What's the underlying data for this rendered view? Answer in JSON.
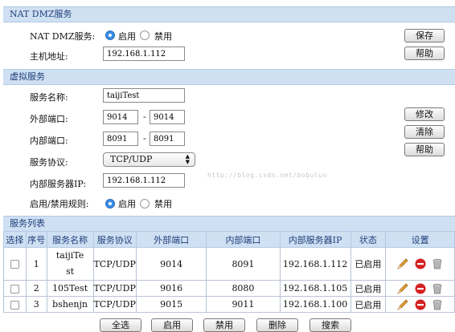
{
  "nat": {
    "header": "NAT DMZ服务",
    "service_label": "NAT DMZ服务:",
    "enable": "启用",
    "disable": "禁用",
    "host_label": "主机地址:",
    "host_value": "192.168.1.112",
    "save": "保存",
    "help": "帮助"
  },
  "virtual": {
    "header": "虚拟服务",
    "name_label": "服务名称:",
    "name_value": "taijiTest",
    "ext_port_label": "外部端口:",
    "ext_from": "9014",
    "ext_to": "9014",
    "int_port_label": "内部端口:",
    "int_from": "8091",
    "int_to": "8091",
    "dash": "-",
    "protocol_label": "服务协议:",
    "protocol_value": "TCP/UDP",
    "ip_label": "内部服务器IP:",
    "ip_value": "192.168.1.112",
    "rule_label": "启用/禁用规则:",
    "enable": "启用",
    "disable": "禁用",
    "modify": "修改",
    "clear": "清除",
    "help": "帮助",
    "watermark": "http://blog.csdn.net/bobuluo"
  },
  "list": {
    "header": "服务列表",
    "columns": [
      "选择",
      "序号",
      "服务名称",
      "服务协议",
      "外部端口",
      "内部端口",
      "内部服务器IP",
      "状态",
      "设置"
    ],
    "rows": [
      {
        "index": "1",
        "name": "taijiTe st",
        "protocol": "TCP/UDP",
        "ext": "9014",
        "int": "8091",
        "ip": "192.168.1.112",
        "status": "已启用"
      },
      {
        "index": "2",
        "name": "105Test",
        "protocol": "TCP/UDP",
        "ext": "9016",
        "int": "8080",
        "ip": "192.168.1.105",
        "status": "已启用"
      },
      {
        "index": "3",
        "name": "bshenjn",
        "protocol": "TCP/UDP",
        "ext": "9015",
        "int": "9011",
        "ip": "192.168.1.100",
        "status": "已启用"
      }
    ],
    "icons": [
      "edit-pencil-icon",
      "disable-icon",
      "delete-trash-icon"
    ],
    "colors": {
      "pencil": "#e8a23a",
      "disable": "#d42020",
      "trash": "#9a9a9a"
    }
  },
  "bottom": {
    "select_all": "全选",
    "enable": "启用",
    "disable": "禁用",
    "delete": "删除",
    "search": "搜索"
  }
}
